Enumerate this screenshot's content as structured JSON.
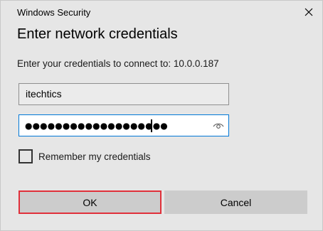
{
  "window": {
    "title": "Windows Security"
  },
  "dialog": {
    "heading": "Enter network credentials",
    "prompt": "Enter your credentials to connect to: 10.0.0.187"
  },
  "username": {
    "value": "itechtics"
  },
  "password": {
    "masked_value": "●●●●●●●●●●●●●●●●●●●",
    "reveal_icon": "eye-icon"
  },
  "remember": {
    "label": "Remember my credentials",
    "checked": false
  },
  "buttons": {
    "ok_label": "OK",
    "cancel_label": "Cancel"
  },
  "colors": {
    "focus_border": "#0078d7",
    "ok_highlight": "#e0303a",
    "dialog_background": "#e6e6e6"
  }
}
